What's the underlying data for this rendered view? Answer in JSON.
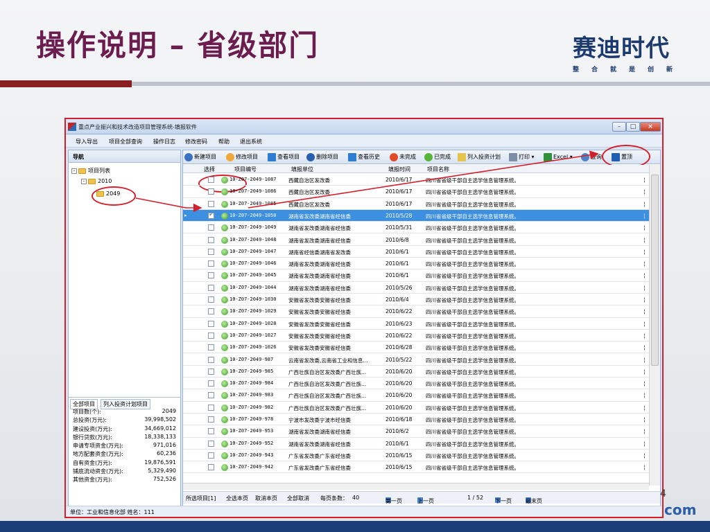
{
  "slide": {
    "title": "操作说明 – 省级部门",
    "brand_name": "赛迪时代",
    "brand_tagline": "整合就是创新",
    "page_number": "4",
    "com_text": "com"
  },
  "window": {
    "title": "重点产业振兴和技术改造项目管理系统-填报软件"
  },
  "menu": [
    "导入导出",
    "项目全部查询",
    "操作日志",
    "修改密码",
    "帮助",
    "退出系统"
  ],
  "nav": {
    "header": "导航",
    "tree": [
      {
        "label": "项目列表",
        "toggle": "-"
      },
      {
        "label": "2010",
        "toggle": "-"
      },
      {
        "label": "2049",
        "toggle": ""
      }
    ]
  },
  "stats": {
    "tabs": [
      "全部项目",
      "列入投资计划项目"
    ],
    "rows": [
      {
        "label": "项目数(个):",
        "value": "2049"
      },
      {
        "label": "总投资(万元):",
        "value": "39,998,502"
      },
      {
        "label": "建设投资(万元):",
        "value": "34,669,012"
      },
      {
        "label": "银行贷款(万元):",
        "value": "18,338,133"
      },
      {
        "label": "申请专项资金(万元):",
        "value": "971,016"
      },
      {
        "label": "地方配套资金(万元):",
        "value": "60,236"
      },
      {
        "label": "自有资金(万元):",
        "value": "19,876,591"
      },
      {
        "label": "铺底流动资金(万元):",
        "value": "5,329,490"
      },
      {
        "label": "其他资金(万元):",
        "value": "752,526"
      }
    ]
  },
  "toolbar": {
    "new": "新建项目",
    "edit": "修改项目",
    "view": "查看项目",
    "delete": "删除项目",
    "history": "查看历史",
    "unfinished": "未完成",
    "finished": "已完成",
    "plan": "列入投资计划",
    "print": "打印",
    "excel": "Excel",
    "query": "查询",
    "top": "置顶"
  },
  "grid": {
    "headers": {
      "select": "选择",
      "id": "项目编号",
      "unit": "填报单位",
      "date": "填报时间",
      "name": "项目名称"
    },
    "rows": [
      {
        "id": "10-Z07-2049-1087",
        "unit": "西藏自治区发改委",
        "date": "2010/6/17",
        "name": "四川省省级干部自主选学信息管理系统。",
        "checked": false,
        "selected": false
      },
      {
        "id": "10-Z07-2049-1086",
        "unit": "西藏自治区发改委",
        "date": "2010/6/17",
        "name": "四川省省级干部自主选学信息管理系统。",
        "checked": false,
        "selected": false
      },
      {
        "id": "10-Z07-2049-1085",
        "unit": "西藏自治区发改委",
        "date": "2010/6/17",
        "name": "四川省省级干部自主选学信息管理系统。",
        "checked": false,
        "selected": false
      },
      {
        "id": "10-Z07-2049-1050",
        "unit": "湖南省发改委湖南省经信委",
        "date": "2010/5/28",
        "name": "四川省省级干部自主选学信息管理系统。",
        "checked": true,
        "selected": true
      },
      {
        "id": "10-Z07-2049-1049",
        "unit": "湖南省发改委湖南省经信委",
        "date": "2010/5/31",
        "name": "四川省省级干部自主选学信息管理系统。",
        "checked": false,
        "selected": false
      },
      {
        "id": "10-Z07-2049-1048",
        "unit": "湖南省发改委湖南省经信委",
        "date": "2010/6/8",
        "name": "四川省省级干部自主选学信息管理系统。",
        "checked": false,
        "selected": false
      },
      {
        "id": "10-Z07-2049-1047",
        "unit": "湖南省经信委湖南省发改委",
        "date": "2010/6/1",
        "name": "四川省省级干部自主选学信息管理系统。",
        "checked": false,
        "selected": false
      },
      {
        "id": "10-Z07-2049-1046",
        "unit": "湖南省发改委湖南省经信委",
        "date": "2010/6/1",
        "name": "四川省省级干部自主选学信息管理系统。",
        "checked": false,
        "selected": false
      },
      {
        "id": "10-Z07-2049-1045",
        "unit": "湖南省发改委湖南省经信委",
        "date": "2010/6/1",
        "name": "四川省省级干部自主选学信息管理系统。",
        "checked": false,
        "selected": false
      },
      {
        "id": "10-Z07-2049-1044",
        "unit": "湖南省发改委湖南省经信委",
        "date": "2010/5/26",
        "name": "四川省省级干部自主选学信息管理系统。",
        "checked": false,
        "selected": false
      },
      {
        "id": "10-Z07-2049-1030",
        "unit": "安徽省发改委安徽省经信委",
        "date": "2010/6/4",
        "name": "四川省省级干部自主选学信息管理系统。",
        "checked": false,
        "selected": false
      },
      {
        "id": "10-Z07-2049-1029",
        "unit": "安徽省发改委安徽省经信委",
        "date": "2010/6/22",
        "name": "四川省省级干部自主选学信息管理系统。",
        "checked": false,
        "selected": false
      },
      {
        "id": "10-Z07-2049-1028",
        "unit": "安徽省发改委安徽省经信委",
        "date": "2010/6/23",
        "name": "四川省省级干部自主选学信息管理系统。",
        "checked": false,
        "selected": false
      },
      {
        "id": "10-Z07-2049-1027",
        "unit": "安徽省发改委安徽省经信委",
        "date": "2010/6/22",
        "name": "四川省省级干部自主选学信息管理系统。",
        "checked": false,
        "selected": false
      },
      {
        "id": "10-Z07-2049-1026",
        "unit": "安徽省发改委安徽省经信委",
        "date": "2010/6/28",
        "name": "四川省省级干部自主选学信息管理系统。",
        "checked": false,
        "selected": false
      },
      {
        "id": "10-Z07-2049-987",
        "unit": "云南省发改委,云南省工业和信息...",
        "date": "2010/5/22",
        "name": "四川省省级干部自主选学信息管理系统。",
        "checked": false,
        "selected": false
      },
      {
        "id": "10-Z07-2049-985",
        "unit": "广西壮族自治区发改委广西壮族...",
        "date": "2010/6/20",
        "name": "四川省省级干部自主选学信息管理系统。",
        "checked": false,
        "selected": false
      },
      {
        "id": "10-Z07-2049-984",
        "unit": "广西壮族自治区发改委广西壮族...",
        "date": "2010/6/20",
        "name": "四川省省级干部自主选学信息管理系统。",
        "checked": false,
        "selected": false
      },
      {
        "id": "10-Z07-2049-983",
        "unit": "广西壮族自治区发改委广西壮族...",
        "date": "2010/6/20",
        "name": "四川省省级干部自主选学信息管理系统。",
        "checked": false,
        "selected": false
      },
      {
        "id": "10-Z07-2049-982",
        "unit": "广西壮族自治区发改委广西壮族...",
        "date": "2010/6/20",
        "name": "四川省省级干部自主选学信息管理系统。",
        "checked": false,
        "selected": false
      },
      {
        "id": "10-Z07-2049-978",
        "unit": "宁波市发改委宁波市经信委",
        "date": "2010/6/18",
        "name": "四川省省级干部自主选学信息管理系统。",
        "checked": false,
        "selected": false
      },
      {
        "id": "10-Z07-2049-953",
        "unit": "湖南省发改委湖南省经信委",
        "date": "2010/6/2",
        "name": "四川省省级干部自主选学信息管理系统。",
        "checked": false,
        "selected": false
      },
      {
        "id": "10-Z07-2049-952",
        "unit": "湖南省发改委湖南省经信委",
        "date": "2010/6/1",
        "name": "四川省省级干部自主选学信息管理系统。",
        "checked": false,
        "selected": false
      },
      {
        "id": "10-Z07-2049-943",
        "unit": "广东省发改委广东省经信委",
        "date": "2010/6/15",
        "name": "四川省省级干部自主选学信息管理系统。",
        "checked": false,
        "selected": false
      },
      {
        "id": "10-Z07-2049-942",
        "unit": "广东省发改委广东省经信委",
        "date": "2010/6/15",
        "name": "四川省省级干部自主选学信息管理系统。",
        "checked": false,
        "selected": false
      }
    ]
  },
  "pager": {
    "selected_items": "所选项目[1]",
    "select_page": "全选本页",
    "cancel_page": "取消本页",
    "cancel_all": "全部取消",
    "per_page_label": "每页条数：",
    "per_page_value": "40",
    "first": "第一页",
    "prev": "上一页",
    "page_info": "1 / 52",
    "next": "下一页",
    "last": "最末页"
  },
  "statusbar": {
    "text": "单位：工业和信息化部  姓名：111"
  },
  "colors": {
    "title": "#6b1d4f",
    "highlight_red": "#d21f2b",
    "selected_row": "#3d8fe0"
  }
}
